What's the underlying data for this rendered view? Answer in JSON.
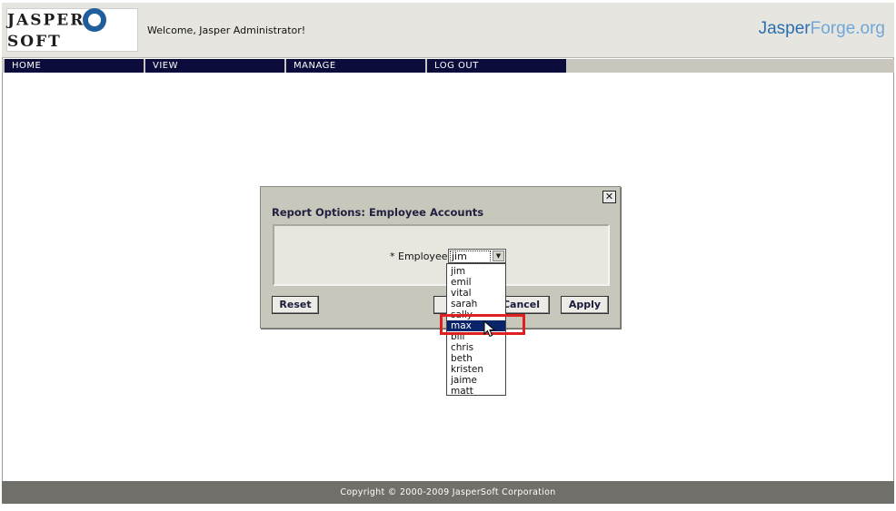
{
  "header": {
    "logo_text_1": "JASPER",
    "logo_text_2": "SOFT",
    "welcome": "Welcome, Jasper Administrator!",
    "forge_part1": "Jasper",
    "forge_part2": "Forge.org"
  },
  "nav": {
    "items": [
      {
        "label": "HOME"
      },
      {
        "label": "VIEW"
      },
      {
        "label": "MANAGE"
      },
      {
        "label": "LOG OUT"
      }
    ]
  },
  "dialog": {
    "title": "Report Options: Employee Accounts",
    "close_symbol": "✕",
    "employee_label": "* Employee",
    "employee_value": "jim",
    "buttons": {
      "reset": "Reset",
      "ok_hidden": "",
      "cancel": "Cancel",
      "apply": "Apply"
    }
  },
  "dropdown": {
    "options": [
      "jim",
      "emil",
      "vital",
      "sarah",
      "sally",
      "max",
      "bill",
      "chris",
      "beth",
      "kristen",
      "jaime",
      "matt"
    ],
    "selected": "max"
  },
  "footer": {
    "copyright": "Copyright © 2000-2009 JasperSoft Corporation"
  },
  "colors": {
    "nav_bg": "#0c0c3c",
    "selected_bg": "#0a246a",
    "highlight": "#e02020",
    "footer_bg": "#706f6a"
  }
}
